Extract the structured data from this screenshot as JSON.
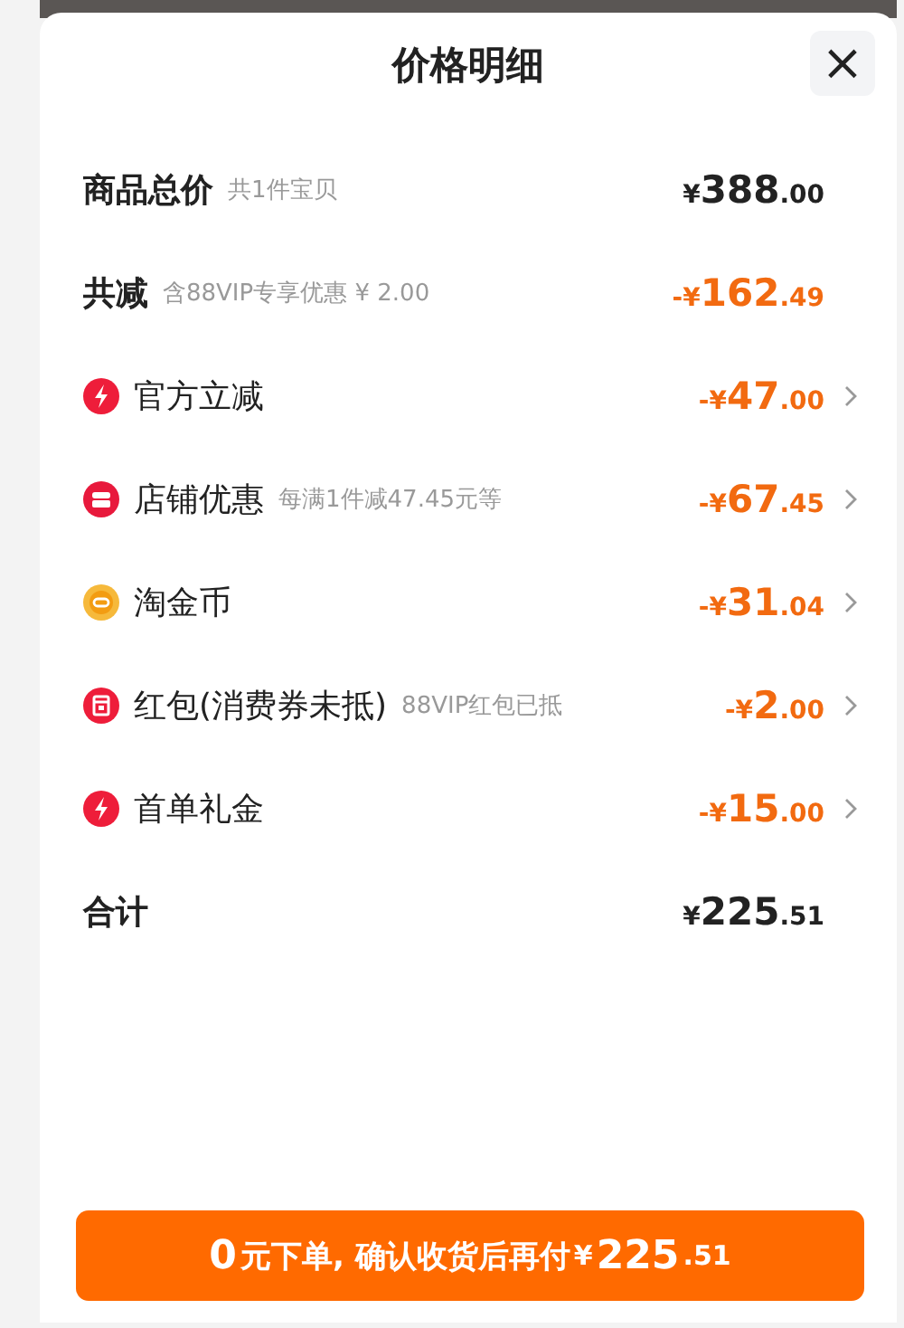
{
  "sheet": {
    "title": "价格明细",
    "close": "×"
  },
  "rows": [
    {
      "kind": "total",
      "label": "商品总价",
      "note": "共1件宝贝",
      "amount": "¥388.00"
    },
    {
      "kind": "total",
      "label": "共减",
      "note": "含88VIP专享优惠 ¥ 2.00",
      "amount": "-¥162.49",
      "highlight": true
    },
    {
      "kind": "bolt",
      "label": "官方立减",
      "amount": "-¥47.00"
    },
    {
      "kind": "shop",
      "label": "店铺优惠",
      "note": "每满1件减47.45元等",
      "amount": "-¥67.45"
    },
    {
      "kind": "coin",
      "label": "淘金币",
      "amount": "-¥31.04"
    },
    {
      "kind": "packet",
      "label": "红包(消费券未抵)",
      "note": "88VIP红包已抵",
      "amount": "-¥2.00"
    },
    {
      "kind": "bolt",
      "label": "首单礼金",
      "amount": "-¥15.00"
    },
    {
      "kind": "total",
      "label": "合计",
      "amount": "¥225.51"
    }
  ],
  "button": {
    "lead": "0",
    "text": "元下单, 确认收货后再付",
    "amount": "¥225.51"
  }
}
